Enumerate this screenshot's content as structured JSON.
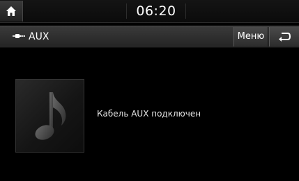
{
  "status_bar": {
    "time": "06:20"
  },
  "header": {
    "title": "AUX",
    "menu_label": "Меню"
  },
  "main": {
    "message": "Кабель AUX подключен"
  },
  "icons": {
    "home": "home-icon",
    "source": "aux-cable-icon",
    "back": "back-arrow-icon",
    "art": "music-note-icon"
  },
  "colors": {
    "background": "#000000",
    "bar": "#2c2c2c",
    "text": "#ffffff"
  }
}
